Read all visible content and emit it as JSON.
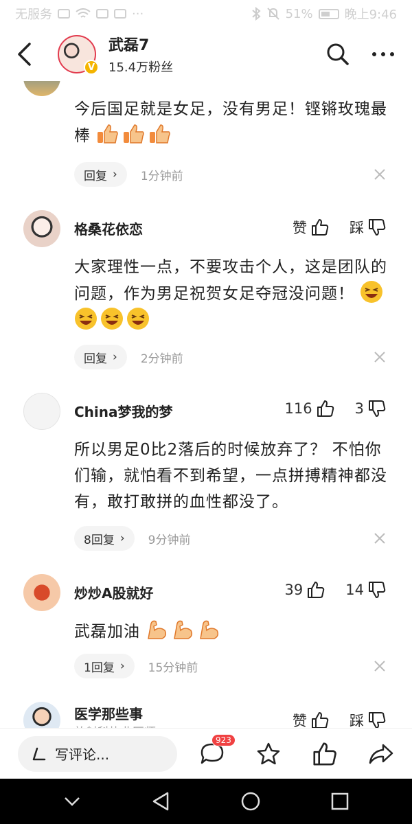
{
  "status_bar": {
    "carrier": "无服务",
    "battery": "51%",
    "time": "晚上9:46"
  },
  "header": {
    "name": "武磊7",
    "fans": "15.4万粉丝"
  },
  "comments": [
    {
      "name": "",
      "text": "今后国足就是女足，没有男足！铿锵玫瑰最棒",
      "emoji_count": 3,
      "reply_label": "回复",
      "time": "1分钟前"
    },
    {
      "name": "格桑花依恋",
      "like_label": "赞",
      "dislike_label": "踩",
      "text": "大家理性一点，不要攻击个人，这是团队的问题，作为男足祝贺女足夺冠没问题！",
      "emoji_count": 4,
      "reply_label": "回复",
      "time": "2分钟前"
    },
    {
      "name": "China梦我的梦",
      "like_label": "116",
      "dislike_label": "3",
      "text": "所以男足0比2落后的时候放弃了？ 不怕你们输，就怕看不到希望，一点拼搏精神都没有，敢打敢拼的血性都没了。",
      "reply_label": "8回复",
      "time": "9分钟前"
    },
    {
      "name": "炒炒A股就好",
      "like_label": "39",
      "dislike_label": "14",
      "text": "武磊加油",
      "emoji_count": 3,
      "reply_label": "1回复",
      "time": "15分钟前"
    },
    {
      "name": "医学那些事",
      "subtitle": "放射科执业医师",
      "like_label": "赞",
      "dislike_label": "踩"
    }
  ],
  "bottom_bar": {
    "write_placeholder": "写评论...",
    "comment_badge": "923"
  },
  "colors": {
    "badge": "#f04142",
    "verify": "#f4b400"
  }
}
